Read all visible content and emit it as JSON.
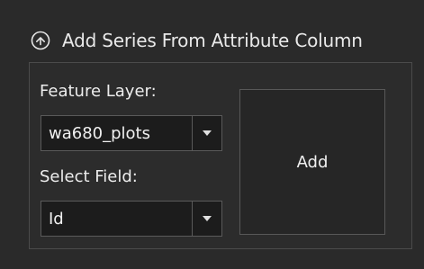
{
  "header": {
    "title": "Add Series From Attribute Column",
    "collapse_icon": "chevron-up-circle-icon"
  },
  "feature_layer": {
    "label": "Feature Layer:",
    "value": "wa680_plots"
  },
  "select_field": {
    "label": "Select Field:",
    "value": "Id"
  },
  "add_button": {
    "label": "Add"
  }
}
